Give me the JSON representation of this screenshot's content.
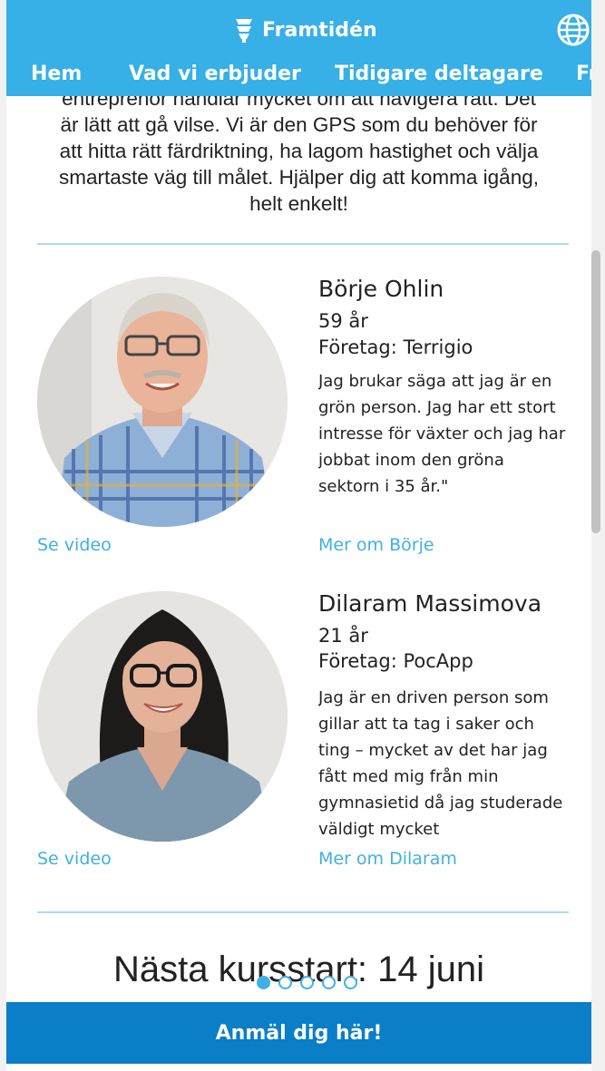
{
  "header": {
    "brand": "Framtidén",
    "nav": [
      "Hem",
      "Vad vi erbjuder",
      "Tidigare deltagare",
      "Fr"
    ]
  },
  "intro": {
    "cut_line": "entreprenör handlar mycket om att navigera rätt. Det",
    "lines": [
      "är lätt att gå vilse. Vi är den GPS som du behöver för",
      "att hitta rätt färdriktning, ha lagom hastighet och välja",
      "smartaste väg till målet. Hjälper dig att komma igång,",
      "helt enkelt!"
    ]
  },
  "participants": [
    {
      "name": "Börje Ohlin",
      "age": "59 år",
      "company": "Företag: Terrigio",
      "quote": "Jag brukar säga att jag är en grön person. Jag har ett stort intresse för växter och jag har jobbat inom den gröna sektorn i 35 år.\"",
      "video_link": "Se video",
      "more_link": "Mer om Börje"
    },
    {
      "name": "Dilaram Massimova",
      "age": "21 år",
      "company": "Företag: PocApp",
      "quote": "Jag är en driven person som gillar att ta tag i saker och ting – mycket av det har jag fått med mig från min gymnasietid då jag studerade väldigt mycket",
      "video_link": "Se video",
      "more_link": "Mer om Dilaram"
    }
  ],
  "next_course": "Nästa kursstart: 14 juni",
  "carousel": {
    "count": 5,
    "active": 0
  },
  "cta": "Anmäl dig här!",
  "colors": {
    "header": "#36b0e6",
    "cta": "#0a7ec7",
    "link": "#3fb0e6",
    "divider": "#a9dbf2"
  }
}
